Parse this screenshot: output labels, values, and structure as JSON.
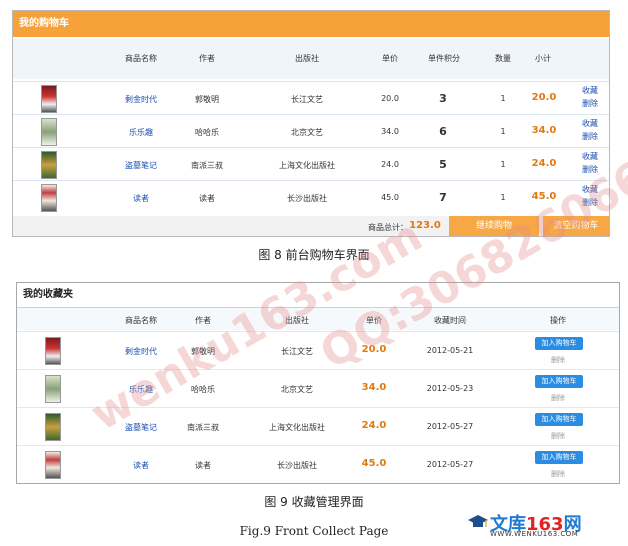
{
  "cart": {
    "title": "我的购物车",
    "headers": [
      "商品名称",
      "作者",
      "出版社",
      "单价",
      "单件积分",
      "数量",
      "小计"
    ],
    "rows": [
      {
        "name": "剩金时代",
        "author": "郭敬明",
        "publisher": "长江文艺",
        "price": "20.0",
        "points": "3",
        "qty": "1",
        "subtotal": "20.0",
        "fav": "收藏",
        "del": "删除"
      },
      {
        "name": "乐乐趣",
        "author": "哈哈乐",
        "publisher": "北京文艺",
        "price": "34.0",
        "points": "6",
        "qty": "1",
        "subtotal": "34.0",
        "fav": "收藏",
        "del": "删除"
      },
      {
        "name": "盗墓笔记",
        "author": "南派三叔",
        "publisher": "上海文化出版社",
        "price": "24.0",
        "points": "5",
        "qty": "1",
        "subtotal": "24.0",
        "fav": "收藏",
        "del": "删除"
      },
      {
        "name": "读者",
        "author": "读者",
        "publisher": "长沙出版社",
        "price": "45.0",
        "points": "7",
        "qty": "1",
        "subtotal": "45.0",
        "fav": "收藏",
        "del": "删除"
      }
    ],
    "total_label": "商品总计：",
    "total_value": "123.0",
    "continue_btn": "继续购物",
    "clear_btn": "清空购物车",
    "accent": "#f6a13a"
  },
  "caption1": "图 8  前台购物车界面",
  "fav": {
    "title": "我的收藏夹",
    "headers": [
      "商品名称",
      "作者",
      "出版社",
      "单价",
      "收藏时间",
      "操作"
    ],
    "rows": [
      {
        "name": "剩金时代",
        "author": "郭敬明",
        "publisher": "长江文艺",
        "price": "20.0",
        "date": "2012-05-21",
        "add": "加入购物车",
        "del": "删除"
      },
      {
        "name": "乐乐趣",
        "author": "哈哈乐",
        "publisher": "北京文艺",
        "price": "34.0",
        "date": "2012-05-23",
        "add": "加入购物车",
        "del": "删除"
      },
      {
        "name": "盗墓笔记",
        "author": "南派三叔",
        "publisher": "上海文化出版社",
        "price": "24.0",
        "date": "2012-05-27",
        "add": "加入购物车",
        "del": "删除"
      },
      {
        "name": "读者",
        "author": "读者",
        "publisher": "长沙出版社",
        "price": "45.0",
        "date": "2012-05-27",
        "add": "加入购物车",
        "del": "删除"
      }
    ]
  },
  "caption2": "图 9  收藏管理界面",
  "caption3": "Fig.9 Front Collect Page",
  "watermark1": "wenku163.com",
  "watermark2": "QQ:306826066",
  "logo": {
    "text_a": "文库",
    "text_b": "163",
    "text_c": "网",
    "url": "WWW.WENKU163.COM"
  }
}
